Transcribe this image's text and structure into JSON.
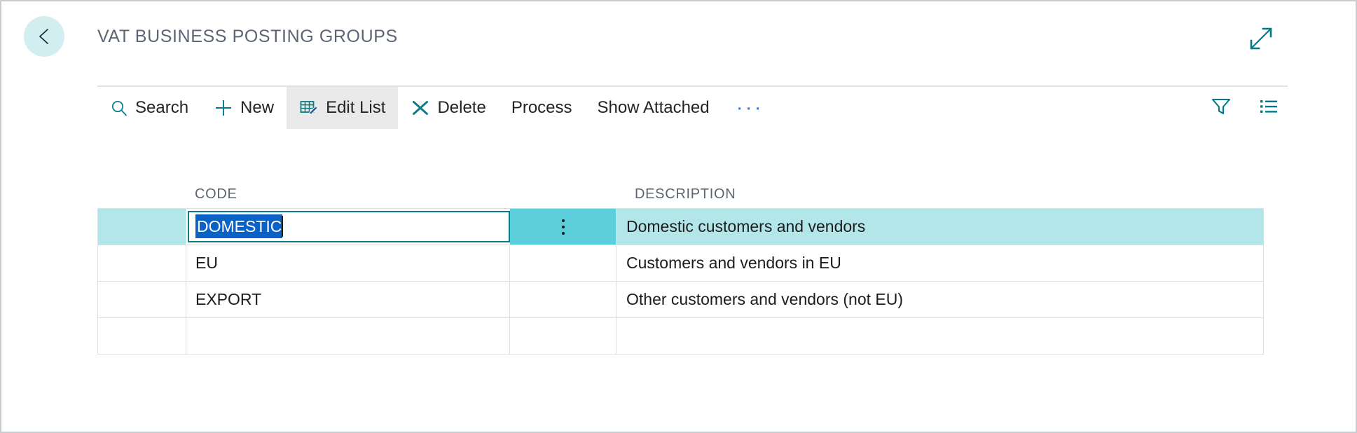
{
  "window": {
    "title": "VAT BUSINESS POSTING GROUPS",
    "back_icon": "back-arrow-icon",
    "expand_icon": "expand-diagonal-icon",
    "accent_teal": "#0d7b84",
    "selection_blue": "#0a62c6",
    "row_highlight": "#b3e6e9",
    "dots_cell_highlight": "#5ccfdb",
    "back_circle_bg": "#d3eef1",
    "title_color": "#5b6573"
  },
  "toolbar": {
    "items": [
      {
        "label": "Search",
        "icon": "search-icon",
        "active": false
      },
      {
        "label": "New",
        "icon": "plus-icon",
        "active": false
      },
      {
        "label": "Edit List",
        "icon": "edit-list-icon",
        "active": true
      },
      {
        "label": "Delete",
        "icon": "x-close-icon",
        "active": false
      },
      {
        "label": "Process",
        "icon": "",
        "active": false
      },
      {
        "label": "Show Attached",
        "icon": "",
        "active": false
      }
    ],
    "overflow_label": "···",
    "right_icons": [
      {
        "name": "filter-funnel-icon"
      },
      {
        "name": "list-view-icon"
      }
    ]
  },
  "grid": {
    "columns": [
      {
        "key": "code",
        "header": "CODE"
      },
      {
        "key": "description",
        "header": "DESCRIPTION"
      }
    ],
    "rows": [
      {
        "code": "DOMESTIC",
        "description": "Domestic customers and vendors",
        "selected": true,
        "editing": true,
        "row_menu_icon": "vertical-ellipsis-icon"
      },
      {
        "code": "EU",
        "description": "Customers and vendors in EU",
        "selected": false,
        "editing": false,
        "row_menu_icon": ""
      },
      {
        "code": "EXPORT",
        "description": "Other customers and vendors (not EU)",
        "selected": false,
        "editing": false,
        "row_menu_icon": ""
      },
      {
        "code": "",
        "description": "",
        "selected": false,
        "editing": false,
        "row_menu_icon": ""
      }
    ]
  }
}
